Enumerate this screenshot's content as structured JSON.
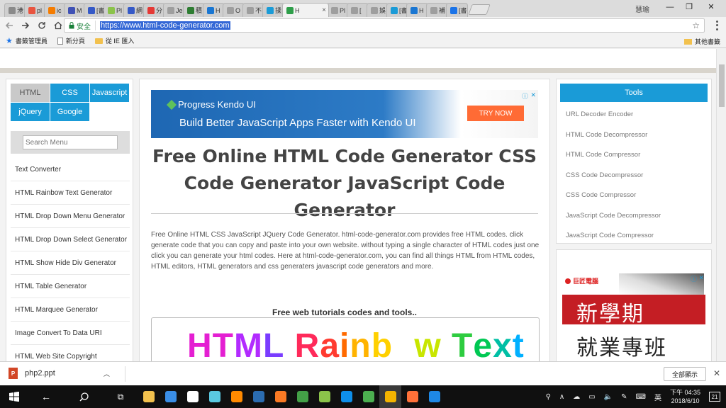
{
  "browser": {
    "tabs": [
      {
        "label": "港",
        "color": "#8a8a8a"
      },
      {
        "label": "pl",
        "color": "#e9543f"
      },
      {
        "label": "ic",
        "color": "#f57c00"
      },
      {
        "label": "M",
        "color": "#3f51b5"
      },
      {
        "label": "[書",
        "color": "#3559c7"
      },
      {
        "label": "Pl",
        "color": "#8bc34a"
      },
      {
        "label": "網",
        "color": "#3559c7"
      },
      {
        "label": "分",
        "color": "#e53935"
      },
      {
        "label": "Je",
        "color": "#9e9e9e"
      },
      {
        "label": "積",
        "color": "#2e7d32"
      },
      {
        "label": "H",
        "color": "#1976d2"
      },
      {
        "label": "O",
        "color": "#9e9e9e"
      },
      {
        "label": "不",
        "color": "#9e9e9e"
      },
      {
        "label": "揉",
        "color": "#1a9bd7"
      },
      {
        "label": "H",
        "color": "#2e9e4a",
        "active": true
      },
      {
        "label": "Pl",
        "color": "#9e9e9e"
      },
      {
        "label": "[",
        "color": "#9e9e9e"
      },
      {
        "label": "娛",
        "color": "#9e9e9e"
      },
      {
        "label": "[書",
        "color": "#1a9bd7"
      },
      {
        "label": "H",
        "color": "#1976d2"
      },
      {
        "label": "補",
        "color": "#9e9e9e"
      },
      {
        "label": "[書",
        "color": "#1a73e8"
      }
    ],
    "active_tab_close": "×",
    "profile_name": "慧瑜",
    "window_controls": {
      "minimize": "—",
      "maximize": "❐",
      "close": "✕"
    },
    "address": {
      "secure_label": "安全",
      "url": "https://www.html-code-generator.com"
    },
    "bookmarks": [
      {
        "icon": "star-icon",
        "label": "書籤管理員"
      },
      {
        "icon": "page-icon",
        "label": "新分頁"
      },
      {
        "icon": "folder-icon",
        "label": "從 IE 匯入"
      }
    ],
    "other_bookmarks": "其他書籤"
  },
  "page": {
    "left_tabs": [
      "HTML",
      "CSS",
      "Javascript",
      "jQuery",
      "Google"
    ],
    "search_placeholder": "Search Menu",
    "menu": [
      "Text Converter",
      "HTML Rainbow Text Generator",
      "HTML Drop Down Menu Generator",
      "HTML Drop Down Select Generator",
      "HTML Show Hide Div Generator",
      "HTML Table Generator",
      "HTML Marquee Generator",
      "Image Convert To Data URI",
      "HTML Web Site Copyright Generator"
    ],
    "ad": {
      "brand": "Progress Kendo UI",
      "headline": "Build Better JavaScript Apps Faster with Kendo UI",
      "cta": "TRY NOW"
    },
    "title": "Free Online HTML Code Generator CSS Code Generator JavaScript Code Generator",
    "description": "Free Online HTML CSS JavaScript JQuery Code Generator. html-code-generator.com provides free HTML codes. click generate code that you can copy and paste into your own website. without typing a single character of HTML codes just one click you can generate your html codes. Here at html-code-generator.com, you can find all things HTML from HTML codes, HTML editors, HTML generators and css generaters javascript code generators and more.",
    "subhead": "Free web tutorials codes and tools..",
    "rainbow_text": "HTML Rainbow Text",
    "tools_title": "Tools",
    "tools": [
      "URL Decoder Encoder",
      "HTML Code Decompressor",
      "HTML Code Compressor",
      "CSS Code Decompressor",
      "CSS Code Compressor",
      "JavaScript Code Decompressor",
      "JavaScript Code Compressor"
    ],
    "ad2": {
      "logo": "巨匠電腦",
      "line1": "新學期",
      "line2": "就業專班"
    }
  },
  "downloads": {
    "file": "php2.ppt",
    "file_icon_text": "P",
    "show_all": "全部顯示"
  },
  "taskbar": {
    "ime": "英",
    "time": "下午 04:35",
    "date": "2018/6/10",
    "notifications": "21"
  }
}
